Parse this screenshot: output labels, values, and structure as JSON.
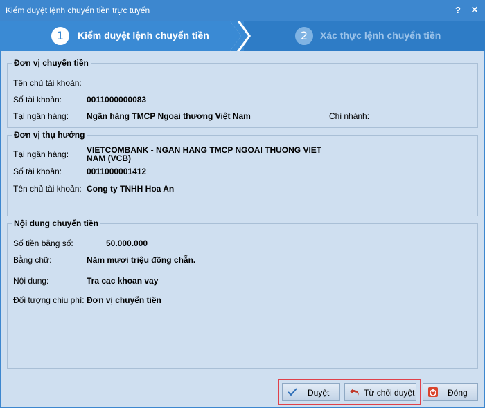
{
  "window": {
    "title": "Kiểm duyệt lệnh chuyển tiền trực tuyến",
    "help": "?",
    "close": "×"
  },
  "steps": [
    {
      "number": "1",
      "label": "Kiểm duyệt lệnh chuyển tiền"
    },
    {
      "number": "2",
      "label": "Xác thực lệnh chuyển tiền"
    }
  ],
  "sender": {
    "title": "Đơn vị chuyển tiền",
    "owner_label": "Tên chủ tài khoản:",
    "owner_value": "",
    "account_label": "Số tài khoản:",
    "account_value": "0011000000083",
    "bank_label": "Tại ngân hàng:",
    "bank_value": "Ngân hàng TMCP Ngoại thương Việt Nam",
    "branch_label": "Chi nhánh:",
    "branch_value": ""
  },
  "beneficiary": {
    "title": "Đơn vị thụ hưởng",
    "bank_label": "Tại ngân hàng:",
    "bank_value_line1": "VIETCOMBANK - NGAN HANG TMCP NGOAI THUONG VIET",
    "bank_value_line2": "NAM (VCB)",
    "account_label": "Số tài khoản:",
    "account_value": "0011000001412",
    "owner_label": "Tên chủ tài khoản:",
    "owner_value": "Cong ty TNHH Hoa An"
  },
  "transfer": {
    "title": "Nội dung chuyển tiền",
    "amount_label": "Số tiền bằng số:",
    "amount_value": "50.000.000",
    "words_label": "Bằng chữ:",
    "words_value": "Năm mươi triệu đồng chẵn.",
    "content_label": "Nội dung:",
    "content_value": "Tra cac khoan vay",
    "fee_label": "Đối tượng chịu phí:",
    "fee_value": "Đơn vị chuyển tiền"
  },
  "buttons": {
    "approve": "Duyệt",
    "reject": "Từ chối duyệt",
    "close": "Đóng"
  },
  "colors": {
    "title_bar": "#3d87cf",
    "panel": "#cfdff0",
    "highlight": "#e0414a"
  }
}
